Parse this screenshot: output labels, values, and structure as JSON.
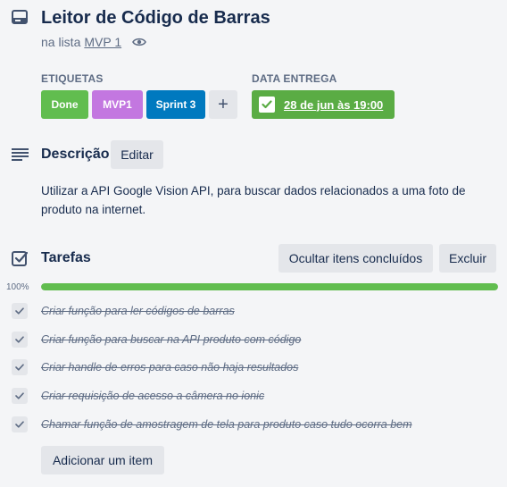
{
  "card": {
    "title": "Leitor de Código de Barras",
    "list_prefix": "na lista",
    "list_name": "MVP 1"
  },
  "labels": {
    "heading": "ETIQUETAS",
    "items": [
      {
        "text": "Done",
        "color": "#61bd4f"
      },
      {
        "text": "MVP1",
        "color": "#c377e0"
      },
      {
        "text": "Sprint 3",
        "color": "#0079bf"
      }
    ],
    "add_symbol": "+"
  },
  "due": {
    "heading": "DATA ENTREGA",
    "date": "28 de jun às 19:00",
    "color": "#5aac44"
  },
  "description": {
    "title": "Descrição",
    "edit_label": "Editar",
    "text": "Utilizar a API Google Vision API, para buscar dados relacionados a uma foto de produto na internet."
  },
  "checklist": {
    "title": "Tarefas",
    "hide_label": "Ocultar itens concluídos",
    "delete_label": "Excluir",
    "progress_text": "100%",
    "progress": 1.0,
    "items": [
      {
        "text": "Criar função para ler códigos de barras",
        "done": true
      },
      {
        "text": "Criar função para buscar na API produto com código",
        "done": true
      },
      {
        "text": "Criar handle de erros para caso não haja resultados",
        "done": true
      },
      {
        "text": "Criar requisição de acesso a câmera no ionic",
        "done": true
      },
      {
        "text": "Chamar função de amostragem de tela para produto caso tudo ocorra bem",
        "done": true
      }
    ],
    "add_label": "Adicionar um item"
  },
  "icons": {
    "card": "card-icon",
    "watch": "eye-icon",
    "description": "text-lines-icon",
    "checklist": "checkbox-icon",
    "check": "check-icon"
  }
}
